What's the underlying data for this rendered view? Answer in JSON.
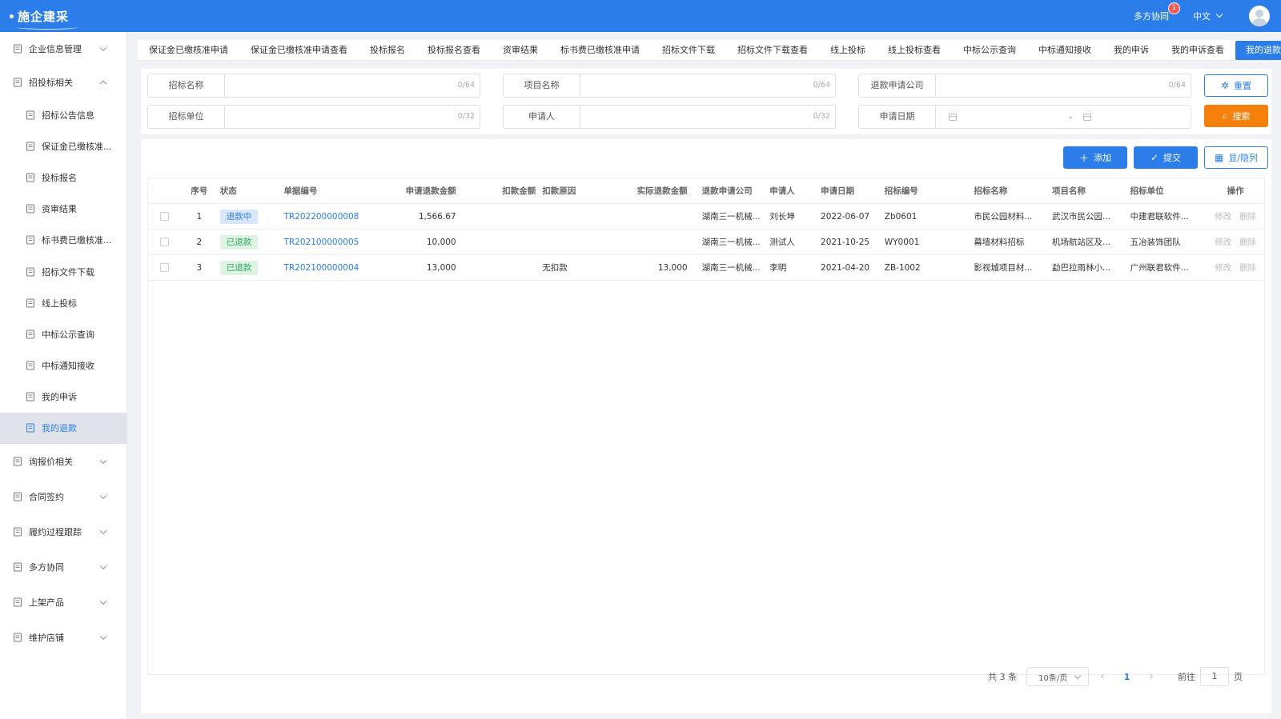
{
  "header": {
    "logo": "施企建采",
    "collab_label": "多方协同",
    "collab_badge": "1",
    "language": "中文"
  },
  "sidebar": {
    "groups": [
      {
        "label": "企业信息管理",
        "icon": "document-icon"
      },
      {
        "label": "招投标相关",
        "icon": "target-icon",
        "expanded": true,
        "items": [
          {
            "label": "招标公告信息",
            "icon": "notice-icon"
          },
          {
            "label": "保证金已缴核准...",
            "icon": "clipboard-icon"
          },
          {
            "label": "投标报名",
            "icon": "user-icon"
          },
          {
            "label": "资审结果",
            "icon": "check-clipboard-icon"
          },
          {
            "label": "标书费已缴核准...",
            "icon": "receipt-icon"
          },
          {
            "label": "招标文件下载",
            "icon": "sitemap-icon"
          },
          {
            "label": "线上投标",
            "icon": "online-bid-icon"
          },
          {
            "label": "中标公示查询",
            "icon": "list-icon"
          },
          {
            "label": "中标通知接收",
            "icon": "user-notice-icon"
          },
          {
            "label": "我的申诉",
            "icon": "appeal-icon"
          },
          {
            "label": "我的退款",
            "icon": "refund-icon",
            "active": true
          }
        ]
      },
      {
        "label": "询报价相关",
        "icon": "quote-icon"
      },
      {
        "label": "合同签约",
        "icon": "contract-icon"
      },
      {
        "label": "履约过程跟踪",
        "icon": "tracking-icon"
      },
      {
        "label": "多方协同",
        "icon": "collab-icon"
      },
      {
        "label": "上架产品",
        "icon": "product-icon"
      },
      {
        "label": "维护店铺",
        "icon": "store-icon"
      }
    ]
  },
  "tabs": [
    "保证金已缴核准申请",
    "保证金已缴核准申请查看",
    "投标报名",
    "投标报名查看",
    "资审结果",
    "标书费已缴核准申请",
    "招标文件下载",
    "招标文件下载查看",
    "线上投标",
    "线上投标查看",
    "中标公示查询",
    "中标通知接收",
    "我的申诉",
    "我的申诉查看",
    "我的退款"
  ],
  "active_tab": "我的退款",
  "filters": {
    "bid_name": {
      "label": "招标名称",
      "count": "0/64"
    },
    "project_name": {
      "label": "项目名称",
      "count": "0/64"
    },
    "refund_company": {
      "label": "退款申请公司",
      "count": "0/64"
    },
    "bid_unit": {
      "label": "招标单位",
      "count": "0/32"
    },
    "applicant": {
      "label": "申请人",
      "count": "0/32"
    },
    "apply_date": {
      "label": "申请日期",
      "separator": "-"
    },
    "reset_label": "重置",
    "search_label": "搜索"
  },
  "toolbar": {
    "add_label": "添加",
    "submit_label": "提交",
    "columns_label": "显/隐列"
  },
  "table": {
    "columns": [
      "序号",
      "状态",
      "单据编号",
      "申请退款金额",
      "扣款金额",
      "扣款原因",
      "实际退款金额",
      "退款申请公司",
      "申请人",
      "申请日期",
      "招标编号",
      "招标名称",
      "项目名称",
      "招标单位",
      "操作"
    ],
    "rows": [
      {
        "idx": "1",
        "status": "退款中",
        "status_color": "#2b7de9",
        "no": "TR202200000008",
        "apply": "1,566.67",
        "deduct": "",
        "reason": "",
        "actual": "",
        "company": "湖南三一机械...",
        "person": "刘长坤",
        "date": "2022-06-07",
        "bidno": "Zb0601",
        "bidname": "市民公园材料...",
        "proj": "武汉市民公园...",
        "unit": "中建君联软件...",
        "edit": "修改",
        "del": "删除"
      },
      {
        "idx": "2",
        "status": "已退款",
        "status_color": "#27a85a",
        "no": "TR202100000005",
        "apply": "10,000",
        "deduct": "",
        "reason": "",
        "actual": "",
        "company": "湖南三一机械...",
        "person": "测试人",
        "date": "2021-10-25",
        "bidno": "WY0001",
        "bidname": "幕墙材料招标",
        "proj": "机场航站区及...",
        "unit": "五冶装饰团队",
        "edit": "修改",
        "del": "删除"
      },
      {
        "idx": "3",
        "status": "已退款",
        "status_color": "#27a85a",
        "no": "TR202100000004",
        "apply": "13,000",
        "deduct": "",
        "reason": "无扣款",
        "actual": "13,000",
        "company": "湖南三一机械...",
        "person": "李明",
        "date": "2021-04-20",
        "bidno": "ZB-1002",
        "bidname": "影视城项目材...",
        "proj": "勐巴拉雨林小...",
        "unit": "广州联君软件...",
        "edit": "修改",
        "del": "删除"
      }
    ]
  },
  "pagination": {
    "total": "共 3 条",
    "page_size": "10条/页",
    "current": "1",
    "goto_label": "前往",
    "goto_value": "1",
    "page_suffix": "页"
  }
}
